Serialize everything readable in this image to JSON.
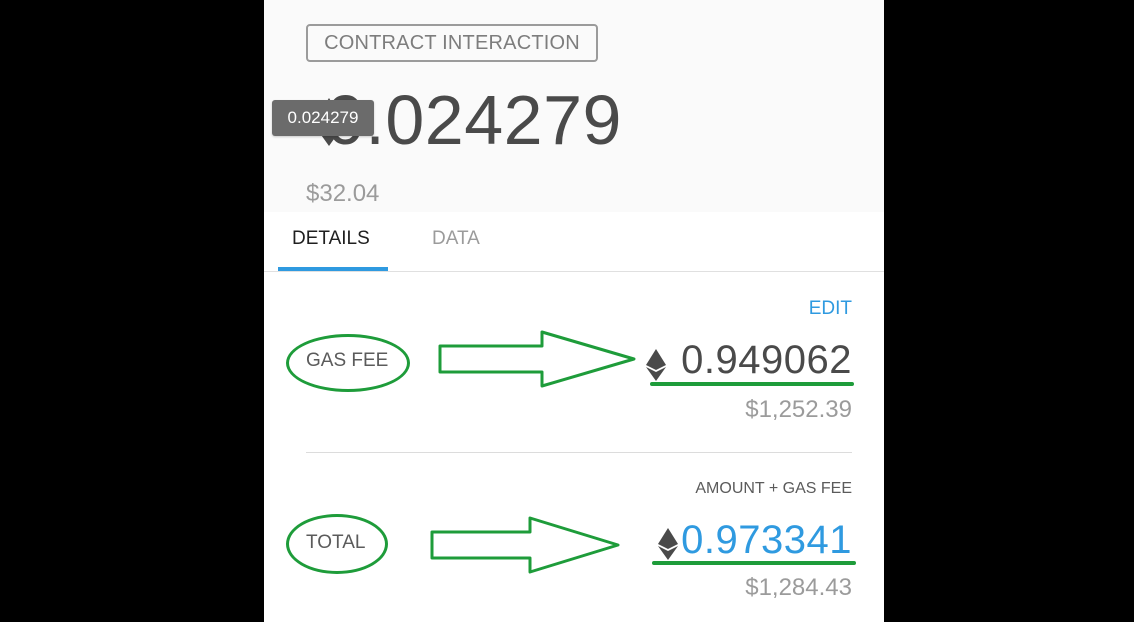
{
  "header": {
    "badge_label": "CONTRACT INTERACTION",
    "amount": "0.024279",
    "amount_fiat": "$32.04",
    "tooltip": "0.024279",
    "currency_icon": "eth-icon"
  },
  "tabs": [
    {
      "label": "DETAILS",
      "active": true
    },
    {
      "label": "DATA",
      "active": false
    }
  ],
  "details": {
    "edit_label": "EDIT",
    "gas_fee": {
      "label": "GAS FEE",
      "value": "0.949062",
      "fiat": "$1,252.39"
    },
    "total": {
      "heading": "AMOUNT + GAS FEE",
      "label": "TOTAL",
      "value": "0.973341",
      "fiat": "$1,284.43"
    }
  },
  "colors": {
    "accent_blue": "#2f9ae0",
    "annotation_green": "#1e9c3a",
    "text_dark": "#4a4a4a",
    "text_muted": "#9b9b9b"
  }
}
